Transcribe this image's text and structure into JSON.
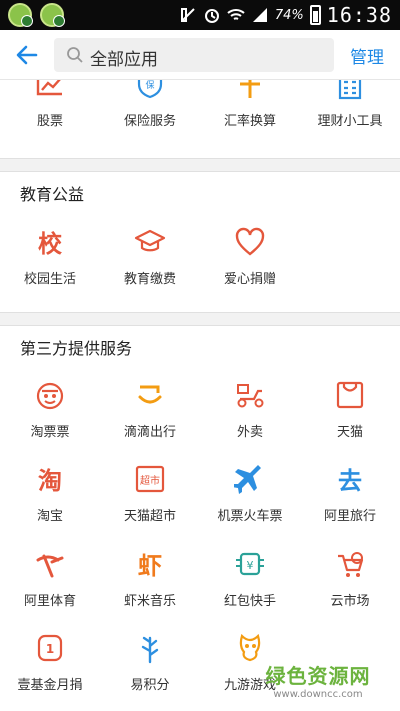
{
  "header": {
    "search_text": "全部应用",
    "manage_label": "管理"
  },
  "top_row": [
    {
      "label": "股票",
      "icon": "stock-chart-icon"
    },
    {
      "label": "保险服务",
      "icon": "insurance-shield-icon"
    },
    {
      "label": "汇率换算",
      "icon": "exchange-icon"
    },
    {
      "label": "理财小工具",
      "icon": "calculator-icon"
    }
  ],
  "education": {
    "title": "教育公益",
    "items": [
      {
        "label": "校园生活",
        "icon": "campus-icon"
      },
      {
        "label": "教育缴费",
        "icon": "graduation-cap-icon"
      },
      {
        "label": "爱心捐赠",
        "icon": "heart-icon"
      }
    ]
  },
  "third_party": {
    "title": "第三方提供服务",
    "items": [
      {
        "label": "淘票票",
        "icon": "taopiaopiao-icon"
      },
      {
        "label": "滴滴出行",
        "icon": "didi-icon"
      },
      {
        "label": "外卖",
        "icon": "scooter-icon"
      },
      {
        "label": "天猫",
        "icon": "tmall-bag-icon"
      },
      {
        "label": "淘宝",
        "icon": "taobao-icon"
      },
      {
        "label": "天猫超市",
        "icon": "supermarket-icon"
      },
      {
        "label": "机票火车票",
        "icon": "airplane-icon"
      },
      {
        "label": "阿里旅行",
        "icon": "travel-icon"
      },
      {
        "label": "阿里体育",
        "icon": "sports-icon"
      },
      {
        "label": "虾米音乐",
        "icon": "xiami-music-icon"
      },
      {
        "label": "红包快手",
        "icon": "red-envelope-icon"
      },
      {
        "label": "云市场",
        "icon": "cloud-market-icon"
      },
      {
        "label": "壹基金月捐",
        "icon": "charity-icon"
      },
      {
        "label": "易积分",
        "icon": "points-icon"
      },
      {
        "label": "九游游戏",
        "icon": "game-icon"
      }
    ]
  },
  "status_bar": {
    "time": "16:38",
    "battery": "74%"
  },
  "watermark": {
    "line1": "绿色资源网",
    "line2": "www.downcc.com"
  },
  "colors": {
    "accent": "#1e88e5",
    "icon_red": "#e4573c",
    "icon_orange": "#f39c12",
    "icon_blue": "#2d8fe0"
  }
}
